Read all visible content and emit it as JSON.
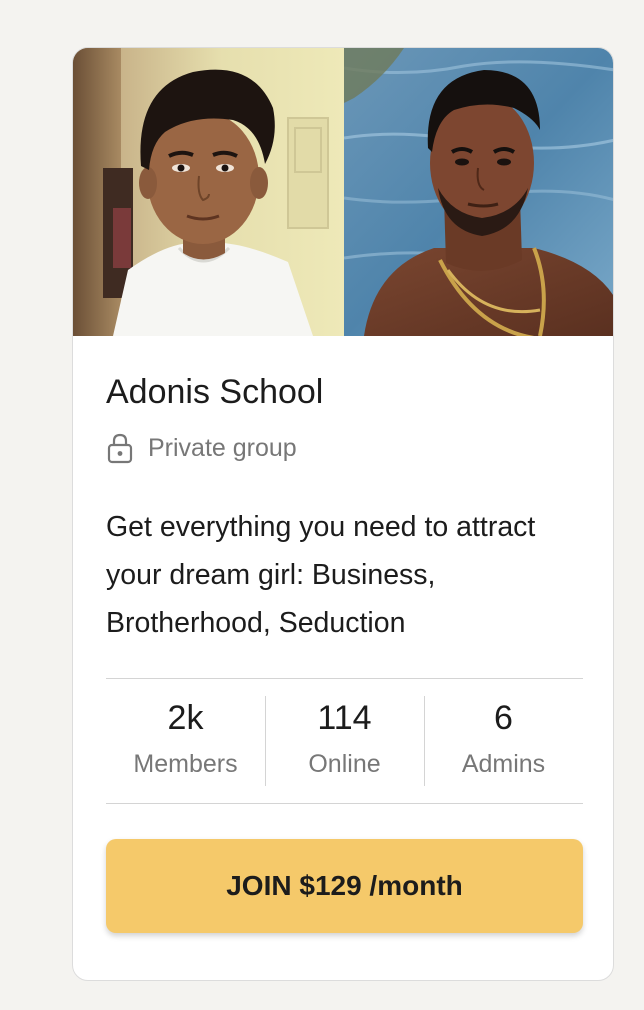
{
  "group": {
    "name": "Adonis School",
    "privacy_label": "Private group",
    "description": "Get everything you need to attract your dream girl: Business, Brotherhood, Seduction"
  },
  "stats": [
    {
      "value": "2k",
      "label": "Members"
    },
    {
      "value": "114",
      "label": "Online"
    },
    {
      "value": "6",
      "label": "Admins"
    }
  ],
  "join_button": {
    "label": "JOIN $129 /month"
  },
  "colors": {
    "accent": "#f5c96a",
    "background": "#f4f3f0",
    "card": "#ffffff",
    "muted_text": "#777777"
  },
  "icons": {
    "privacy": "lock-icon"
  }
}
